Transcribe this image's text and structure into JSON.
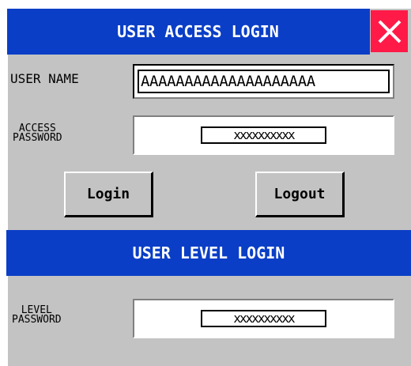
{
  "header": {
    "title": "USER ACCESS LOGIN",
    "close_icon": "close-icon",
    "close_color": "#ff1a48",
    "bar_color": "#0a3ec6"
  },
  "access_form": {
    "user_name_label": "USER NAME",
    "user_name_value": "AAAAAAAAAAAAAAAAAAAA",
    "password_label_line1": "ACCESS",
    "password_label_line2": "PASSWORD",
    "password_mask": "xxxxxxxxxx"
  },
  "buttons": {
    "login_label": "Login",
    "logout_label": "Logout"
  },
  "level_section": {
    "title": "USER LEVEL LOGIN",
    "password_label_line1": "LEVEL",
    "password_label_line2": "PASSWORD",
    "password_mask": "xxxxxxxxxx"
  }
}
